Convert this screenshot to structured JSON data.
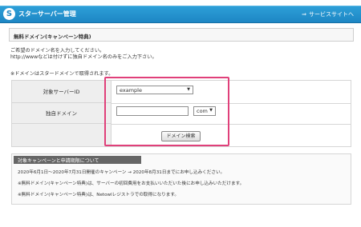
{
  "header": {
    "logo_glyph": "S",
    "title": "スターサーバー管理",
    "link_arrow": "⇒",
    "link_label": "サービスサイトへ"
  },
  "section": {
    "title": "無料ドメイン(キャンペーン特典)"
  },
  "intro": {
    "line1": "ご希望のドメイン名を入力してください。",
    "line2": "http://wwwなどは付けずに独自ドメイン名のみをご入力下さい。",
    "note": "※ドメインはスタードメインで取得されます。"
  },
  "form": {
    "server_label": "対象サーバーID",
    "server_value": "example",
    "domain_label": "独自ドメイン",
    "domain_value": "",
    "tld_value": "com",
    "search_button": "ドメイン検索"
  },
  "campaign": {
    "tab_label": "対象キャンペーンと申請期限について",
    "line1": "2020年6月1日～2020年7月31日開催のキャンペーン → 2020年8月31日までにお申し込みください。",
    "line2": "※無料ドメイン(キャンペーン特典)は、サーバーの初回費用をお支払いいただいた後にお申し込みいただけます。",
    "line3": "※無料ドメイン(キャンペーン特典)は、Netowlレジストラでの取得になります。"
  }
}
